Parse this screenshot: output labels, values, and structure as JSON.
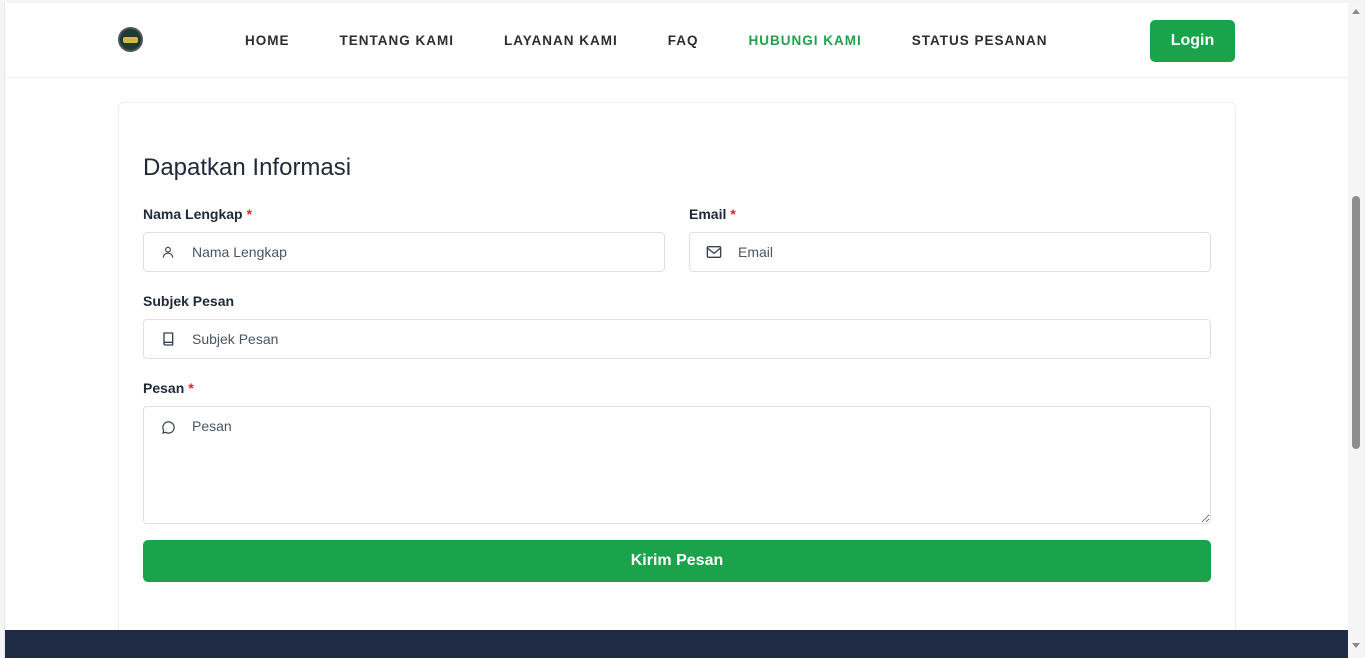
{
  "nav": {
    "logo_icon": "brand-logo",
    "links": [
      {
        "label": "HOME",
        "active": false
      },
      {
        "label": "TENTANG KAMI",
        "active": false
      },
      {
        "label": "LAYANAN KAMI",
        "active": false
      },
      {
        "label": "FAQ",
        "active": false
      },
      {
        "label": "HUBUNGI KAMI",
        "active": true
      },
      {
        "label": "STATUS PESANAN",
        "active": false
      }
    ],
    "login_label": "Login"
  },
  "form": {
    "title": "Dapatkan Informasi",
    "name": {
      "label": "Nama Lengkap",
      "required_mark": "*",
      "placeholder": "Nama Lengkap",
      "value": "",
      "icon": "user-icon"
    },
    "email": {
      "label": "Email",
      "required_mark": "*",
      "placeholder": "Email",
      "value": "",
      "icon": "mail-icon"
    },
    "subject": {
      "label": "Subjek Pesan",
      "placeholder": "Subjek Pesan",
      "value": "",
      "icon": "book-icon"
    },
    "message": {
      "label": "Pesan",
      "required_mark": "*",
      "placeholder": "Pesan",
      "value": "",
      "icon": "chat-bubble-icon"
    },
    "submit_label": "Kirim Pesan"
  },
  "colors": {
    "accent": "#1aa34a",
    "active_link": "#22a04b",
    "required": "#dc2626",
    "footer": "#1f2a44"
  }
}
